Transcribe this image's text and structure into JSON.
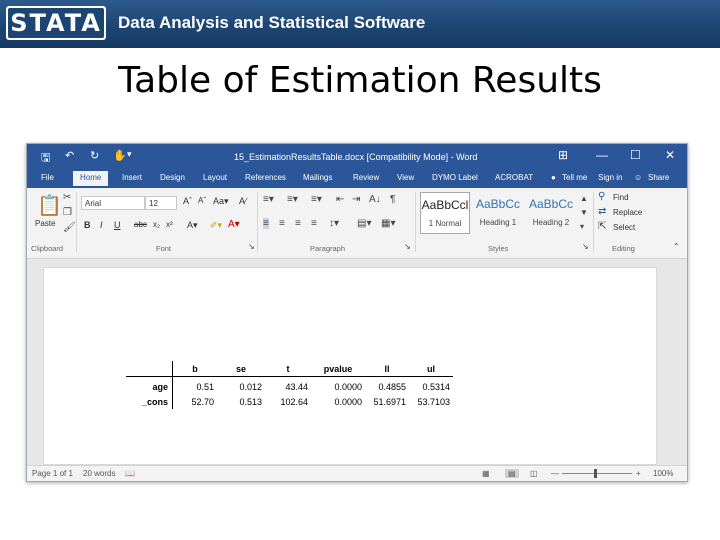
{
  "slide": {
    "logo_text": "STATA",
    "tagline": "Data Analysis and Statistical Software",
    "title": "Table of Estimation Results"
  },
  "word": {
    "window_title": "15_EstimationResultsTable.docx [Compatibility Mode] - Word",
    "tabs": [
      "File",
      "Home",
      "Insert",
      "Design",
      "Layout",
      "References",
      "Mailings",
      "Review",
      "View",
      "DYMO Label",
      "ACROBAT",
      "Tell me",
      "Sign in",
      "Share"
    ],
    "active_tab": "Home",
    "ribbon": {
      "clipboard": {
        "paste_label": "Paste",
        "group_label": "Clipboard"
      },
      "font": {
        "family": "Arial",
        "size": "12",
        "group_label": "Font"
      },
      "paragraph": {
        "group_label": "Paragraph"
      },
      "styles": {
        "items": [
          {
            "sample": "AaBbCcl",
            "name": "1 Normal"
          },
          {
            "sample": "AaBbCc",
            "name": "Heading 1"
          },
          {
            "sample": "AaBbCc",
            "name": "Heading 2"
          }
        ],
        "group_label": "Styles"
      },
      "editing": {
        "find": "Find",
        "replace": "Replace",
        "select": "Select",
        "group_label": "Editing"
      }
    },
    "status": {
      "page": "Page 1 of 1",
      "words": "20 words",
      "zoom": "100%"
    },
    "icons": [
      "save-icon",
      "undo-icon",
      "redo-icon",
      "touch-mode-icon",
      "ribbon-options-icon",
      "minimize-icon",
      "maximize-icon",
      "close-icon",
      "lightbulb-icon",
      "user-icon",
      "read-mode-icon",
      "print-layout-icon",
      "web-layout-icon"
    ]
  },
  "table": {
    "columns": [
      "b",
      "se",
      "t",
      "pvalue",
      "ll",
      "ul"
    ],
    "rows": [
      {
        "label": "age",
        "values": [
          "0.51",
          "0.012",
          "43.44",
          "0.0000",
          "0.4855",
          "0.5314"
        ]
      },
      {
        "label": "_cons",
        "values": [
          "52.70",
          "0.513",
          "102.64",
          "0.0000",
          "51.6971",
          "53.7103"
        ]
      }
    ]
  },
  "colors": {
    "banner": "#1d4573",
    "word_accent": "#2b579a"
  }
}
